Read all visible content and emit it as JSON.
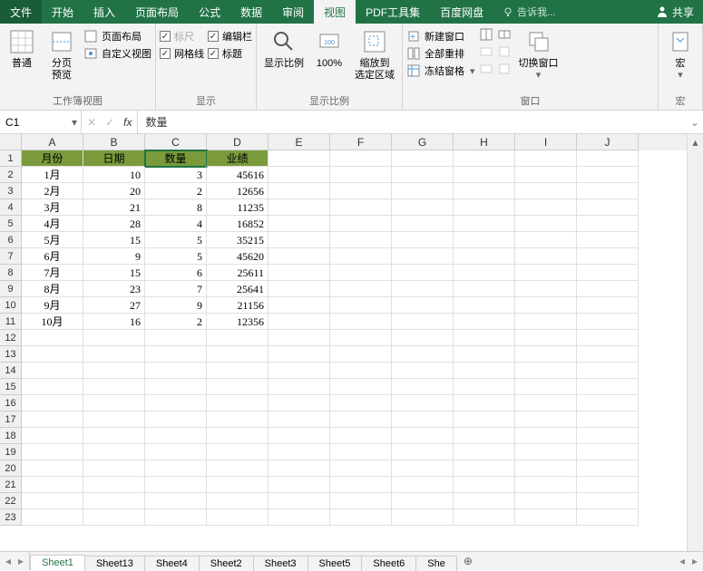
{
  "tabs": {
    "file": "文件",
    "home": "开始",
    "insert": "插入",
    "pageLayout": "页面布局",
    "formulas": "公式",
    "data": "数据",
    "review": "审阅",
    "view": "视图",
    "pdf": "PDF工具集",
    "baidu": "百度网盘",
    "tellme": "告诉我...",
    "share": "共享"
  },
  "ribbon": {
    "workbookViews": {
      "normal": "普通",
      "pageBreak": "分页\n预览",
      "pageLayout": "页面布局",
      "customViews": "自定义视图",
      "label": "工作簿视图"
    },
    "show": {
      "ruler": "标尺",
      "gridlines": "网格线",
      "formulaBar": "编辑栏",
      "headings": "标题",
      "label": "显示"
    },
    "zoom": {
      "zoom": "显示比例",
      "hundred": "100%",
      "zoomSelection": "缩放到\n选定区域",
      "label": "显示比例"
    },
    "window": {
      "newWindow": "新建窗口",
      "arrangeAll": "全部重排",
      "freezePanes": "冻结窗格",
      "switchWindows": "切换窗口",
      "label": "窗口"
    },
    "macros": {
      "macros": "宏",
      "label": "宏"
    }
  },
  "nameBox": "C1",
  "formulaValue": "数量",
  "columns": [
    "A",
    "B",
    "C",
    "D",
    "E",
    "F",
    "G",
    "H",
    "I",
    "J"
  ],
  "rowCount": 23,
  "headerRow": [
    "月份",
    "日期",
    "数量",
    "业绩"
  ],
  "dataRows": [
    [
      "1月",
      "10",
      "3",
      "45616"
    ],
    [
      "2月",
      "20",
      "2",
      "12656"
    ],
    [
      "3月",
      "21",
      "8",
      "11235"
    ],
    [
      "4月",
      "28",
      "4",
      "16852"
    ],
    [
      "5月",
      "15",
      "5",
      "35215"
    ],
    [
      "6月",
      "9",
      "5",
      "45620"
    ],
    [
      "7月",
      "15",
      "6",
      "25611"
    ],
    [
      "8月",
      "23",
      "7",
      "25641"
    ],
    [
      "9月",
      "27",
      "9",
      "21156"
    ],
    [
      "10月",
      "16",
      "2",
      "12356"
    ]
  ],
  "selectedCell": {
    "row": 1,
    "col": 3
  },
  "sheets": [
    "Sheet1",
    "Sheet13",
    "Sheet4",
    "Sheet2",
    "Sheet3",
    "Sheet5",
    "Sheet6",
    "She"
  ],
  "activeSheet": "Sheet1",
  "colors": {
    "accent": "#217346",
    "headerFill": "#7a9a3c"
  }
}
